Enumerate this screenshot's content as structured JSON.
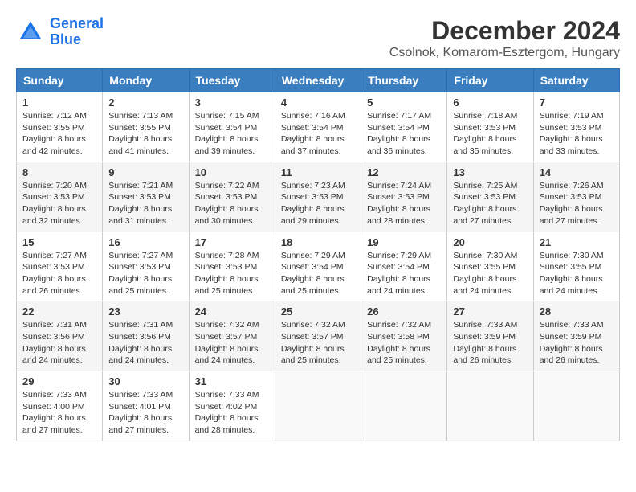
{
  "header": {
    "logo": {
      "line1": "General",
      "line2": "Blue"
    },
    "month": "December 2024",
    "location": "Csolnok, Komarom-Esztergom, Hungary"
  },
  "weekdays": [
    "Sunday",
    "Monday",
    "Tuesday",
    "Wednesday",
    "Thursday",
    "Friday",
    "Saturday"
  ],
  "weeks": [
    [
      {
        "day": "1",
        "sunrise": "Sunrise: 7:12 AM",
        "sunset": "Sunset: 3:55 PM",
        "daylight": "Daylight: 8 hours and 42 minutes."
      },
      {
        "day": "2",
        "sunrise": "Sunrise: 7:13 AM",
        "sunset": "Sunset: 3:55 PM",
        "daylight": "Daylight: 8 hours and 41 minutes."
      },
      {
        "day": "3",
        "sunrise": "Sunrise: 7:15 AM",
        "sunset": "Sunset: 3:54 PM",
        "daylight": "Daylight: 8 hours and 39 minutes."
      },
      {
        "day": "4",
        "sunrise": "Sunrise: 7:16 AM",
        "sunset": "Sunset: 3:54 PM",
        "daylight": "Daylight: 8 hours and 37 minutes."
      },
      {
        "day": "5",
        "sunrise": "Sunrise: 7:17 AM",
        "sunset": "Sunset: 3:54 PM",
        "daylight": "Daylight: 8 hours and 36 minutes."
      },
      {
        "day": "6",
        "sunrise": "Sunrise: 7:18 AM",
        "sunset": "Sunset: 3:53 PM",
        "daylight": "Daylight: 8 hours and 35 minutes."
      },
      {
        "day": "7",
        "sunrise": "Sunrise: 7:19 AM",
        "sunset": "Sunset: 3:53 PM",
        "daylight": "Daylight: 8 hours and 33 minutes."
      }
    ],
    [
      {
        "day": "8",
        "sunrise": "Sunrise: 7:20 AM",
        "sunset": "Sunset: 3:53 PM",
        "daylight": "Daylight: 8 hours and 32 minutes."
      },
      {
        "day": "9",
        "sunrise": "Sunrise: 7:21 AM",
        "sunset": "Sunset: 3:53 PM",
        "daylight": "Daylight: 8 hours and 31 minutes."
      },
      {
        "day": "10",
        "sunrise": "Sunrise: 7:22 AM",
        "sunset": "Sunset: 3:53 PM",
        "daylight": "Daylight: 8 hours and 30 minutes."
      },
      {
        "day": "11",
        "sunrise": "Sunrise: 7:23 AM",
        "sunset": "Sunset: 3:53 PM",
        "daylight": "Daylight: 8 hours and 29 minutes."
      },
      {
        "day": "12",
        "sunrise": "Sunrise: 7:24 AM",
        "sunset": "Sunset: 3:53 PM",
        "daylight": "Daylight: 8 hours and 28 minutes."
      },
      {
        "day": "13",
        "sunrise": "Sunrise: 7:25 AM",
        "sunset": "Sunset: 3:53 PM",
        "daylight": "Daylight: 8 hours and 27 minutes."
      },
      {
        "day": "14",
        "sunrise": "Sunrise: 7:26 AM",
        "sunset": "Sunset: 3:53 PM",
        "daylight": "Daylight: 8 hours and 27 minutes."
      }
    ],
    [
      {
        "day": "15",
        "sunrise": "Sunrise: 7:27 AM",
        "sunset": "Sunset: 3:53 PM",
        "daylight": "Daylight: 8 hours and 26 minutes."
      },
      {
        "day": "16",
        "sunrise": "Sunrise: 7:27 AM",
        "sunset": "Sunset: 3:53 PM",
        "daylight": "Daylight: 8 hours and 25 minutes."
      },
      {
        "day": "17",
        "sunrise": "Sunrise: 7:28 AM",
        "sunset": "Sunset: 3:53 PM",
        "daylight": "Daylight: 8 hours and 25 minutes."
      },
      {
        "day": "18",
        "sunrise": "Sunrise: 7:29 AM",
        "sunset": "Sunset: 3:54 PM",
        "daylight": "Daylight: 8 hours and 25 minutes."
      },
      {
        "day": "19",
        "sunrise": "Sunrise: 7:29 AM",
        "sunset": "Sunset: 3:54 PM",
        "daylight": "Daylight: 8 hours and 24 minutes."
      },
      {
        "day": "20",
        "sunrise": "Sunrise: 7:30 AM",
        "sunset": "Sunset: 3:55 PM",
        "daylight": "Daylight: 8 hours and 24 minutes."
      },
      {
        "day": "21",
        "sunrise": "Sunrise: 7:30 AM",
        "sunset": "Sunset: 3:55 PM",
        "daylight": "Daylight: 8 hours and 24 minutes."
      }
    ],
    [
      {
        "day": "22",
        "sunrise": "Sunrise: 7:31 AM",
        "sunset": "Sunset: 3:56 PM",
        "daylight": "Daylight: 8 hours and 24 minutes."
      },
      {
        "day": "23",
        "sunrise": "Sunrise: 7:31 AM",
        "sunset": "Sunset: 3:56 PM",
        "daylight": "Daylight: 8 hours and 24 minutes."
      },
      {
        "day": "24",
        "sunrise": "Sunrise: 7:32 AM",
        "sunset": "Sunset: 3:57 PM",
        "daylight": "Daylight: 8 hours and 24 minutes."
      },
      {
        "day": "25",
        "sunrise": "Sunrise: 7:32 AM",
        "sunset": "Sunset: 3:57 PM",
        "daylight": "Daylight: 8 hours and 25 minutes."
      },
      {
        "day": "26",
        "sunrise": "Sunrise: 7:32 AM",
        "sunset": "Sunset: 3:58 PM",
        "daylight": "Daylight: 8 hours and 25 minutes."
      },
      {
        "day": "27",
        "sunrise": "Sunrise: 7:33 AM",
        "sunset": "Sunset: 3:59 PM",
        "daylight": "Daylight: 8 hours and 26 minutes."
      },
      {
        "day": "28",
        "sunrise": "Sunrise: 7:33 AM",
        "sunset": "Sunset: 3:59 PM",
        "daylight": "Daylight: 8 hours and 26 minutes."
      }
    ],
    [
      {
        "day": "29",
        "sunrise": "Sunrise: 7:33 AM",
        "sunset": "Sunset: 4:00 PM",
        "daylight": "Daylight: 8 hours and 27 minutes."
      },
      {
        "day": "30",
        "sunrise": "Sunrise: 7:33 AM",
        "sunset": "Sunset: 4:01 PM",
        "daylight": "Daylight: 8 hours and 27 minutes."
      },
      {
        "day": "31",
        "sunrise": "Sunrise: 7:33 AM",
        "sunset": "Sunset: 4:02 PM",
        "daylight": "Daylight: 8 hours and 28 minutes."
      },
      null,
      null,
      null,
      null
    ]
  ]
}
